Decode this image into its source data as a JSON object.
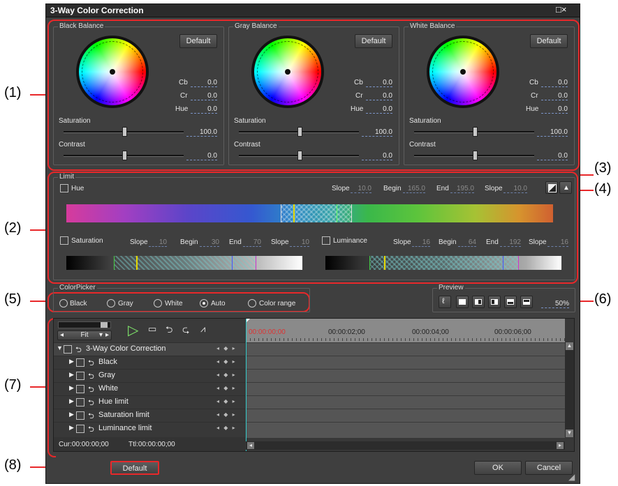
{
  "window": {
    "title": "3-Way Color Correction",
    "controls": "□×"
  },
  "callouts": [
    "(1)",
    "(2)",
    "(3)",
    "(4)",
    "(5)",
    "(6)",
    "(7)",
    "(8)"
  ],
  "balance": [
    {
      "label": "Black Balance",
      "default_btn": "Default",
      "cb_label": "Cb",
      "cb": "0.0",
      "cr_label": "Cr",
      "cr": "0.0",
      "hue_label": "Hue",
      "hue": "0.0",
      "sat_label": "Saturation",
      "sat": "100.0",
      "contrast_label": "Contrast",
      "contrast": "0.0"
    },
    {
      "label": "Gray Balance",
      "default_btn": "Default",
      "cb_label": "Cb",
      "cb": "0.0",
      "cr_label": "Cr",
      "cr": "0.0",
      "hue_label": "Hue",
      "hue": "0.0",
      "sat_label": "Saturation",
      "sat": "100.0",
      "contrast_label": "Contrast",
      "contrast": "0.0"
    },
    {
      "label": "White Balance",
      "default_btn": "Default",
      "cb_label": "Cb",
      "cb": "0.0",
      "cr_label": "Cr",
      "cr": "0.0",
      "hue_label": "Hue",
      "hue": "0.0",
      "sat_label": "Saturation",
      "sat": "100.0",
      "contrast_label": "Contrast",
      "contrast": "0.0"
    }
  ],
  "limit": {
    "label": "Limit",
    "hue": {
      "label": "Hue",
      "slope1_label": "Slope",
      "slope1": "10.0",
      "begin_label": "Begin",
      "begin": "165.0",
      "end_label": "End",
      "end": "195.0",
      "slope2_label": "Slope",
      "slope2": "10.0"
    },
    "saturation": {
      "label": "Saturation",
      "slope1_label": "Slope",
      "slope1": "10",
      "begin_label": "Begin",
      "begin": "30",
      "end_label": "End",
      "end": "70",
      "slope2_label": "Slope",
      "slope2": "10"
    },
    "luminance": {
      "label": "Luminance",
      "slope1_label": "Slope",
      "slope1": "16",
      "begin_label": "Begin",
      "begin": "64",
      "end_label": "End",
      "end": "192",
      "slope2_label": "Slope",
      "slope2": "16"
    }
  },
  "colorpicker": {
    "label": "ColorPicker",
    "options": [
      "Black",
      "Gray",
      "White",
      "Auto",
      "Color range"
    ],
    "selected": "Auto"
  },
  "preview": {
    "label": "Preview",
    "zoom": "50%"
  },
  "timeline": {
    "fit_label": "Fit",
    "times": [
      "00:00:00;00",
      "00:00:02;00",
      "00:00:04;00",
      "00:00:06;00"
    ],
    "tracks": [
      "3-Way Color Correction",
      "Black",
      "Gray",
      "White",
      "Hue limit",
      "Saturation limit",
      "Luminance limit"
    ],
    "keyframe_nav": "◂ ◆ ▸",
    "cur": "Cur:00:00:00;00",
    "ttl": "Ttl:00:00:00;00"
  },
  "footer": {
    "default_btn": "Default",
    "ok_btn": "OK",
    "cancel_btn": "Cancel"
  },
  "colors": {
    "callout_line": "#e8282a",
    "panel_bg": "#3f3f3f",
    "play_green": "#7ee26a"
  }
}
